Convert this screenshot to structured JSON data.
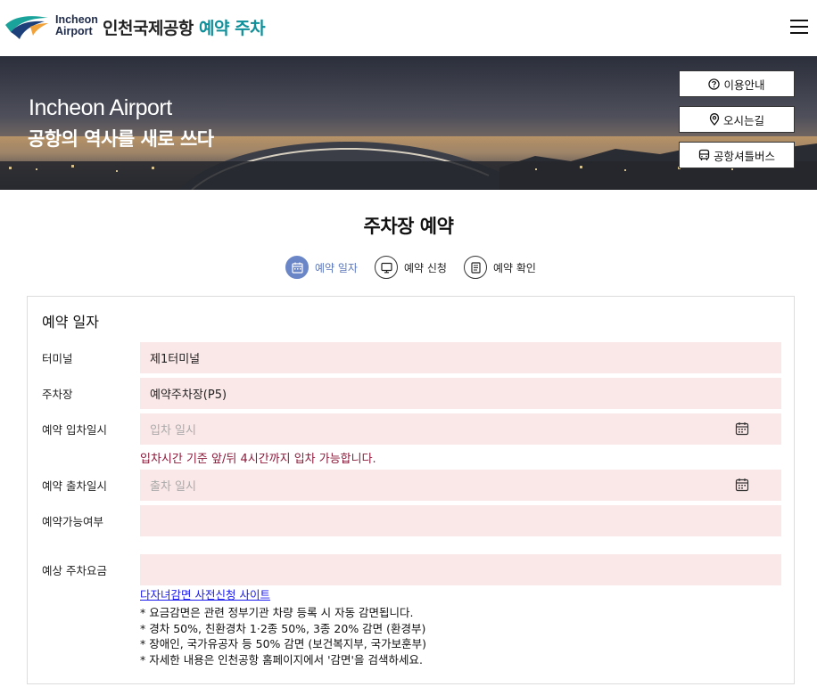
{
  "header": {
    "logo_line1": "Incheon",
    "logo_line2": "Airport",
    "brand_main": "인천국제공항",
    "brand_accent": "예약 주차",
    "accent_color": "#0f8f9a"
  },
  "hero": {
    "title_en": "Incheon Airport",
    "title_ko": "공항의 역사를 새로 쓰다",
    "buttons": [
      {
        "label": "이용안내",
        "icon": "question-circle-icon"
      },
      {
        "label": "오시는길",
        "icon": "map-pin-icon"
      },
      {
        "label": "공항셔틀버스",
        "icon": "bus-icon"
      }
    ]
  },
  "page_title": "주차장 예약",
  "steps": [
    {
      "label": "예약 일자",
      "icon": "calendar-icon",
      "active": true
    },
    {
      "label": "예약 신청",
      "icon": "monitor-icon",
      "active": false
    },
    {
      "label": "예약 확인",
      "icon": "document-icon",
      "active": false
    }
  ],
  "form": {
    "section_title": "예약 일자",
    "terminal": {
      "label": "터미널",
      "value": "제1터미널"
    },
    "parking_lot": {
      "label": "주차장",
      "value": "예약주차장(P5)"
    },
    "entry_time": {
      "label": "예약 입차일시",
      "placeholder": "입차 일시",
      "hint": "입차시간 기준 앞/뒤 4시간까지 입차 가능합니다."
    },
    "exit_time": {
      "label": "예약 출차일시",
      "placeholder": "출차 일시"
    },
    "availability": {
      "label": "예약가능여부",
      "value": ""
    },
    "fee": {
      "label": "예상 주차요금",
      "value": ""
    },
    "discount_link": "다자녀감면 사전신청 사이트",
    "notes": [
      "* 요금감면은 관련 정부기관 차량 등록 시 자동 감면됩니다.",
      "* 경차 50%, 친환경차 1·2종 50%, 3종 20% 감면 (환경부)",
      "* 장애인, 국가유공자 등 50% 감면 (보건복지부, 국가보훈부)",
      "* 자세한 내용은 인천공항 홈페이지에서 '감면'을 검색하세요."
    ]
  },
  "colors": {
    "field_bg": "#fae7e7",
    "hint": "#8b1a3a",
    "step_active": "#6a86c7",
    "link": "#1a1aee"
  }
}
